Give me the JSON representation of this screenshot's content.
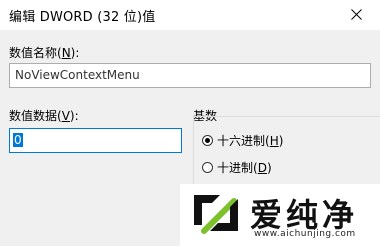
{
  "window": {
    "title": "编辑 DWORD (32 位)值"
  },
  "fields": {
    "name_label_pre": "数值名称(",
    "name_label_key": "N",
    "name_label_post": "):",
    "name_value": "NoViewContextMenu",
    "data_label_pre": "数值数据(",
    "data_label_key": "V",
    "data_label_post": "):",
    "data_value": "0"
  },
  "base": {
    "label": "基数",
    "options": [
      {
        "pre": "十六进制(",
        "key": "H",
        "post": ")",
        "checked": true
      },
      {
        "pre": "十进制(",
        "key": "D",
        "post": ")",
        "checked": false
      }
    ]
  },
  "watermark": {
    "brand": "爱纯净",
    "url": "www.aichunjing.com"
  },
  "colors": {
    "accent": "#0078d7"
  },
  "icons": {
    "close": "close-icon",
    "logo": "aichunjing-logo-icon"
  }
}
